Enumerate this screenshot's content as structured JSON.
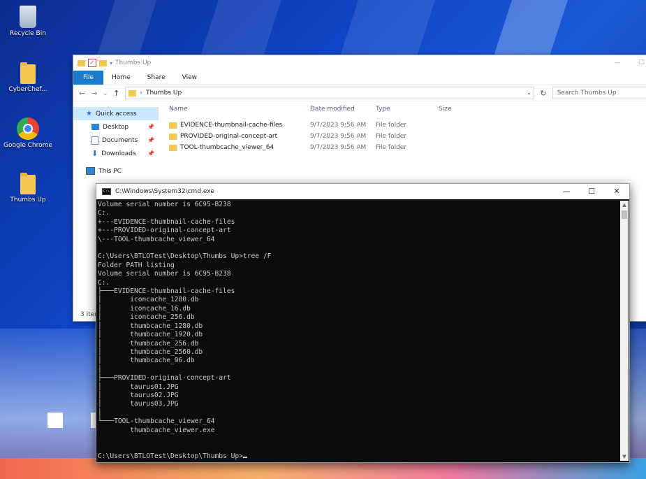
{
  "desktop": {
    "icons": [
      {
        "label": "Recycle Bin",
        "icon": "recycle-bin-icon"
      },
      {
        "label": "CyberChef...",
        "icon": "folder-icon"
      },
      {
        "label": "Google Chrome",
        "icon": "chrome-icon"
      },
      {
        "label": "Thumbs Up",
        "icon": "folder-icon"
      }
    ]
  },
  "explorer": {
    "title": "Thumbs Up",
    "window_controls": {
      "minimize": "—",
      "maximize": "☐"
    },
    "ribbon_tabs": [
      "File",
      "Home",
      "Share",
      "View"
    ],
    "address_path": "Thumbs Up",
    "search_placeholder": "Search Thumbs Up",
    "nav": [
      {
        "label": "Quick access",
        "icon": "star-icon",
        "pinned": false
      },
      {
        "label": "Desktop",
        "icon": "desktop-icon",
        "pinned": true
      },
      {
        "label": "Documents",
        "icon": "documents-icon",
        "pinned": true
      },
      {
        "label": "Downloads",
        "icon": "downloads-icon",
        "pinned": true
      },
      {
        "label": "This PC",
        "icon": "pc-icon",
        "pinned": false
      }
    ],
    "columns": [
      "Name",
      "Date modified",
      "Type",
      "Size"
    ],
    "files": [
      {
        "name": "EVIDENCE-thumbnail-cache-files",
        "date": "9/7/2023 9:56 AM",
        "type": "File folder"
      },
      {
        "name": "PROVIDED-original-concept-art",
        "date": "9/7/2023 9:56 AM",
        "type": "File folder"
      },
      {
        "name": "TOOL-thumbcache_viewer_64",
        "date": "9/7/2023 9:56 AM",
        "type": "File folder"
      }
    ],
    "status": "3 item"
  },
  "cmd": {
    "title": "C:\\Windows\\System32\\cmd.exe",
    "controls": {
      "minimize": "—",
      "maximize": "☐",
      "close": "✕"
    },
    "lines": [
      "Volume serial number is 6C95-B238",
      "C:.",
      "+---EVIDENCE-thumbnail-cache-files",
      "+---PROVIDED-original-concept-art",
      "\\---TOOL-thumbcache_viewer_64",
      "",
      "C:\\Users\\BTLOTest\\Desktop\\Thumbs Up>tree /F",
      "Folder PATH listing",
      "Volume serial number is 6C95-B238",
      "C:.",
      "├───EVIDENCE-thumbnail-cache-files",
      "│       iconcache_1280.db",
      "│       iconcache_16.db",
      "│       iconcache_256.db",
      "│       thumbcache_1280.db",
      "│       thumbcache_1920.db",
      "│       thumbcache_256.db",
      "│       thumbcache_2560.db",
      "│       thumbcache_96.db",
      "│",
      "├───PROVIDED-original-concept-art",
      "│       taurus01.JPG",
      "│       taurus02.JPG",
      "│       taurus03.JPG",
      "│",
      "└───TOOL-thumbcache_viewer_64",
      "        thumbcache_viewer.exe",
      "",
      "",
      "C:\\Users\\BTLOTest\\Desktop\\Thumbs Up>"
    ]
  }
}
